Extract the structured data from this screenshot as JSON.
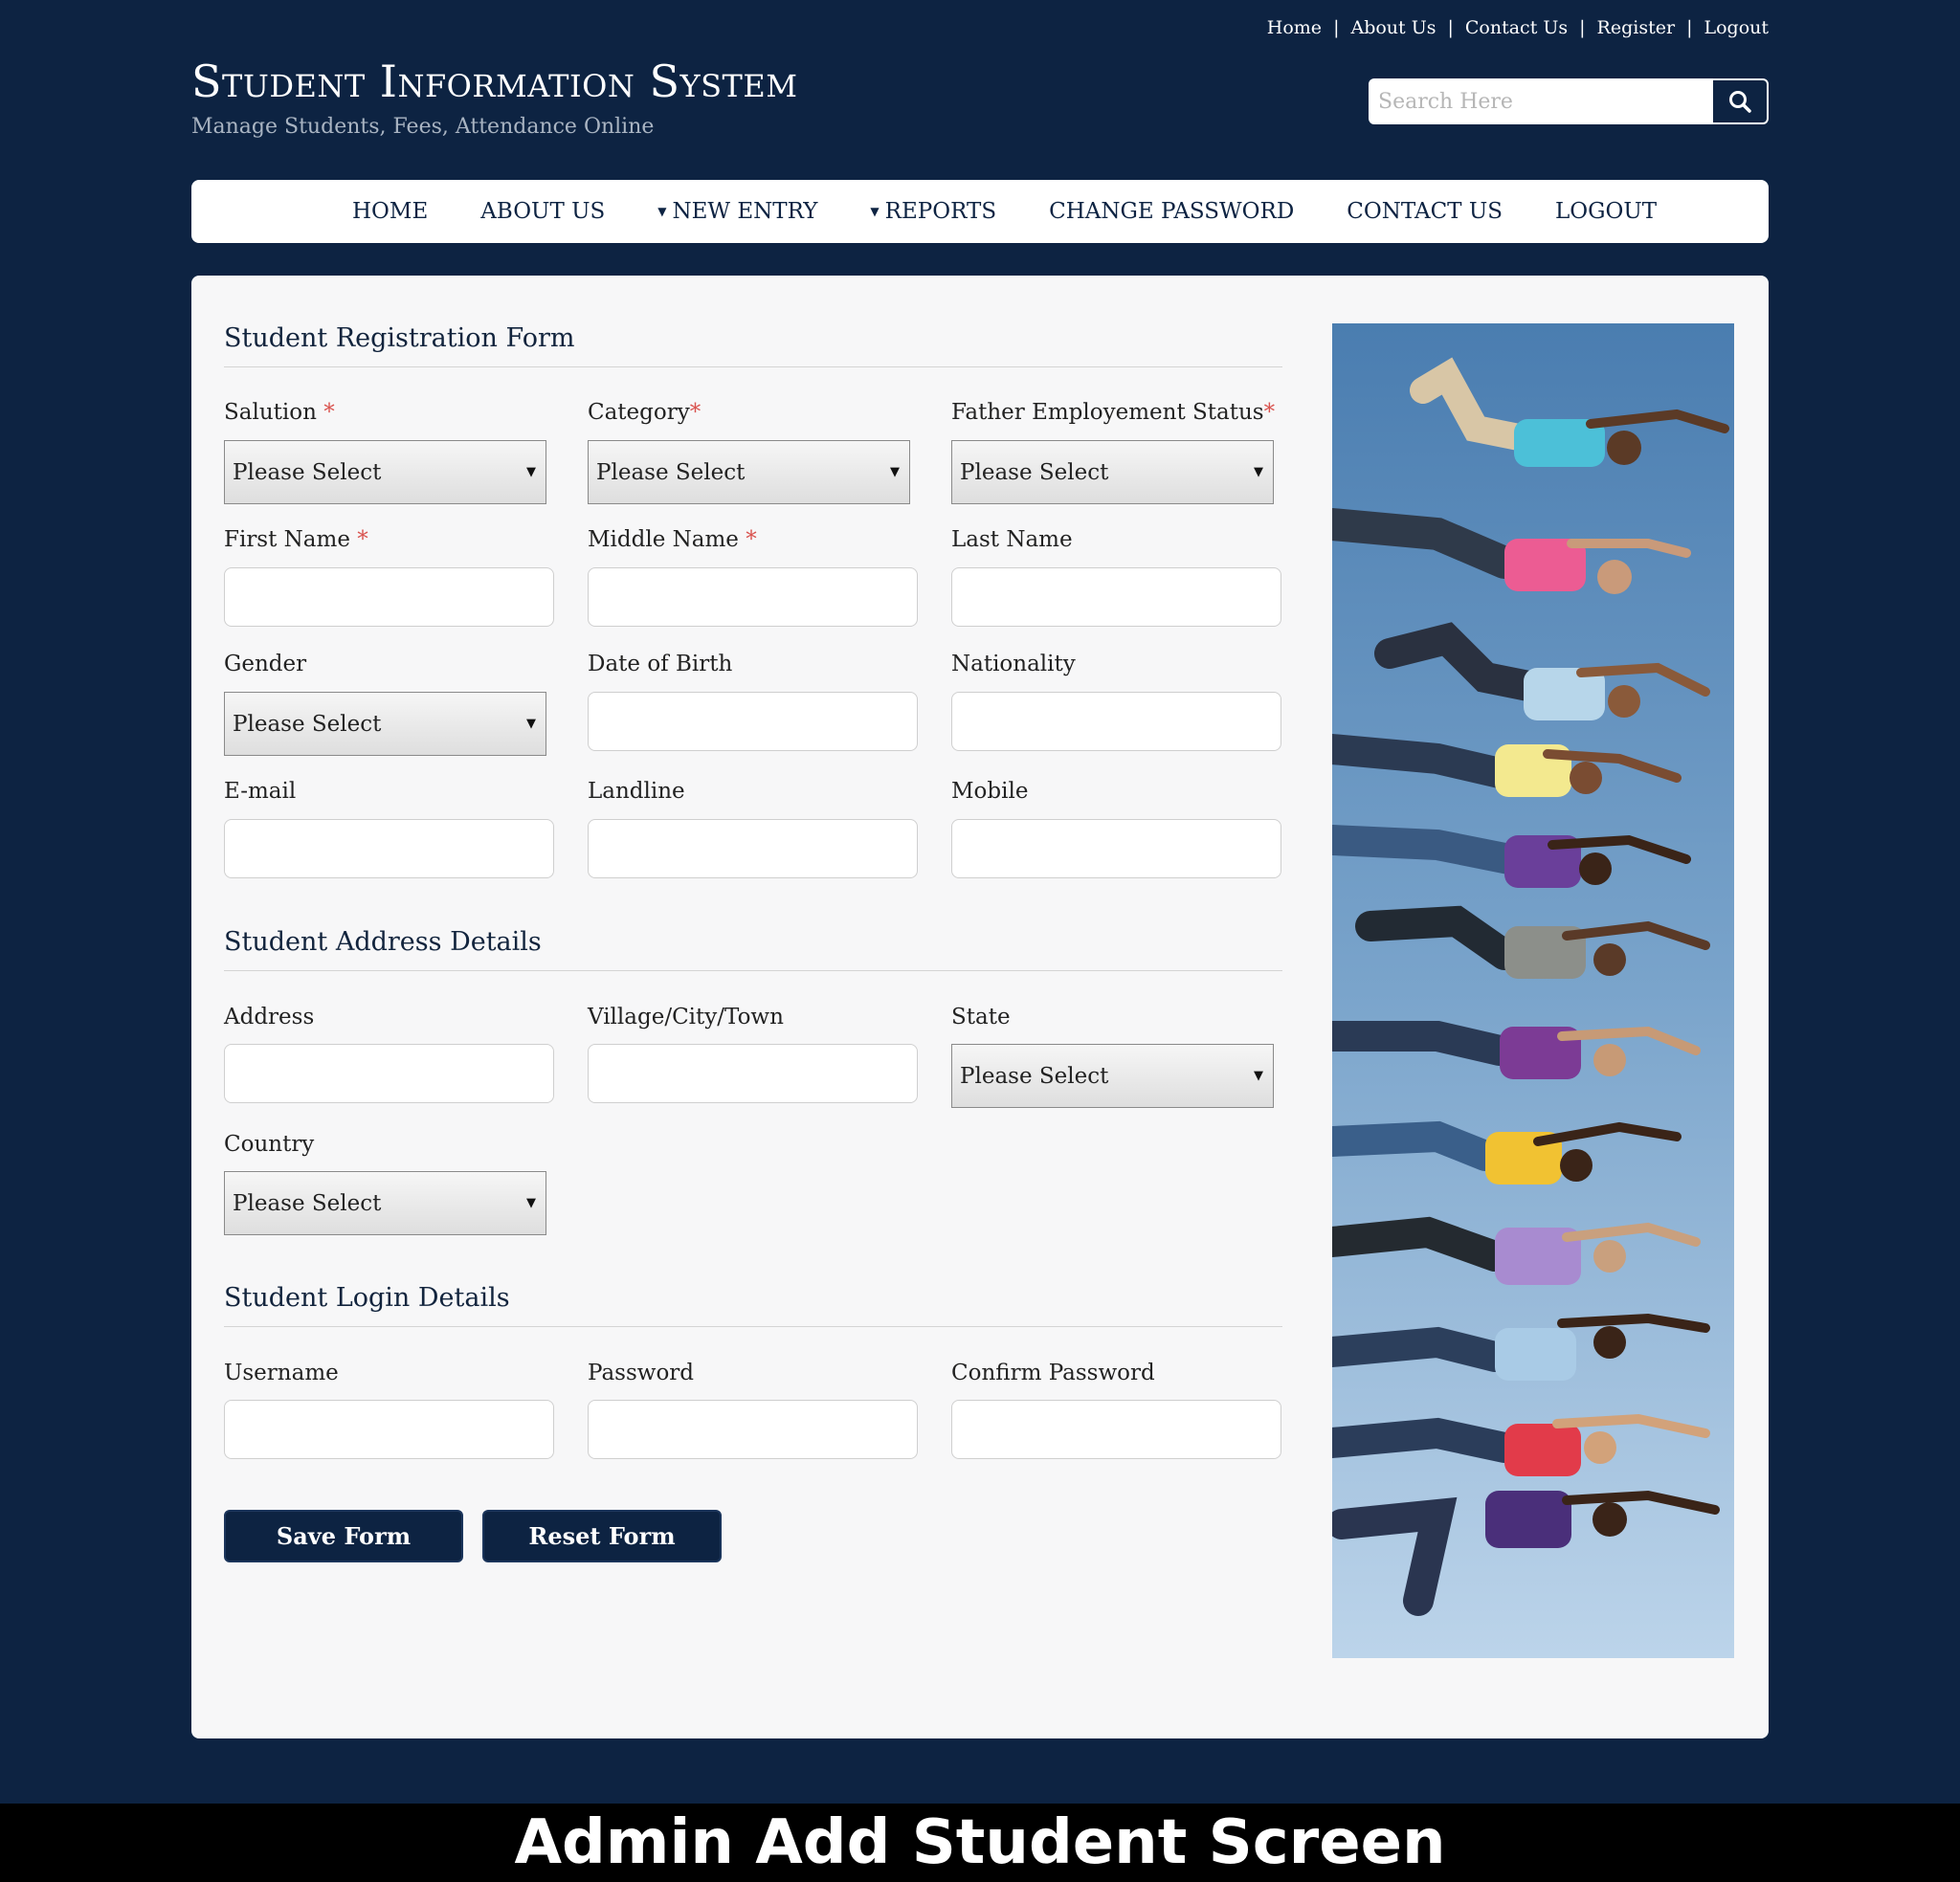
{
  "top_links": [
    "Home",
    "About Us",
    "Contact Us",
    "Register",
    "Logout"
  ],
  "brand": {
    "title": "Student Information System",
    "tagline": "Manage Students, Fees, Attendance Online"
  },
  "search": {
    "placeholder": "Search Here"
  },
  "nav": [
    {
      "label": "HOME",
      "dropdown": false
    },
    {
      "label": "ABOUT US",
      "dropdown": false
    },
    {
      "label": "NEW ENTRY",
      "dropdown": true
    },
    {
      "label": "REPORTS",
      "dropdown": true
    },
    {
      "label": "CHANGE PASSWORD",
      "dropdown": false
    },
    {
      "label": "CONTACT US",
      "dropdown": false
    },
    {
      "label": "LOGOUT",
      "dropdown": false
    }
  ],
  "form": {
    "section_registration": "Student Registration Form",
    "section_address": "Student Address Details",
    "section_login": "Student Login Details",
    "select_placeholder": "Please Select",
    "labels": {
      "salution": "Salution",
      "category": "Category",
      "father_status": "Father Employement Status",
      "first_name": "First Name",
      "middle_name": "Middle Name",
      "last_name": "Last Name",
      "gender": "Gender",
      "dob": "Date of Birth",
      "nationality": "Nationality",
      "email": "E-mail",
      "landline": "Landline",
      "mobile": "Mobile",
      "address": "Address",
      "city": "Village/City/Town",
      "state": "State",
      "country": "Country",
      "username": "Username",
      "password": "Password",
      "confirm_password": "Confirm Password"
    },
    "required_mark": "*",
    "save_label": "Save Form",
    "reset_label": "Reset Form"
  },
  "caption": "Admin Add Student Screen",
  "colors": {
    "navy": "#0d2342",
    "required": "#d9534f"
  }
}
